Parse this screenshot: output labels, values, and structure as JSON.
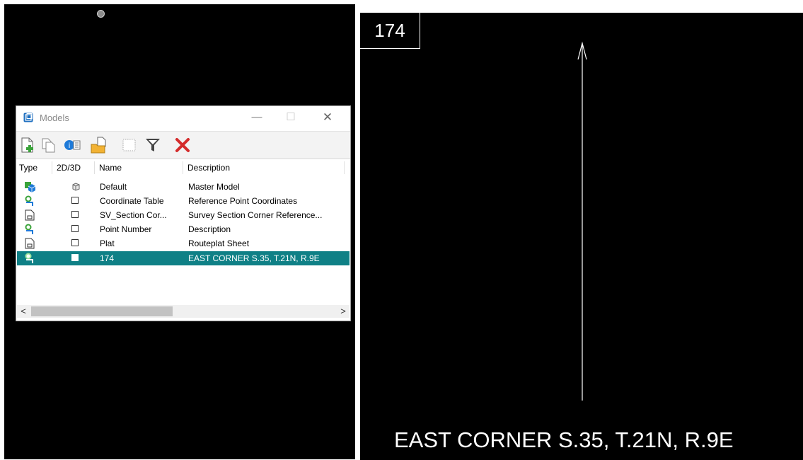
{
  "dialog": {
    "title": "Models",
    "controls": {
      "minimize": "—",
      "maximize": "☐",
      "close": "✕"
    },
    "toolbar": [
      {
        "icon": "new-model-icon"
      },
      {
        "icon": "copy-model-icon"
      },
      {
        "icon": "model-properties-icon"
      },
      {
        "icon": "import-model-icon"
      },
      {
        "icon": "select-icon"
      },
      {
        "icon": "filter-icon"
      },
      {
        "icon": "delete-icon"
      }
    ],
    "columns": [
      "Type",
      "2D/3D",
      "Name",
      "Description"
    ],
    "rows": [
      {
        "type_icon": "3d-model-icon",
        "dim_icon": "cube-icon",
        "name": "Default",
        "description": "Master Model",
        "selected": false
      },
      {
        "type_icon": "design-model-icon",
        "dim_icon": "square-icon",
        "name": "Coordinate Table",
        "description": "Reference Point Coordinates",
        "selected": false
      },
      {
        "type_icon": "sheet-model-icon",
        "dim_icon": "square-icon",
        "name": "SV_Section Cor...",
        "description": "Survey Section Corner Reference...",
        "selected": false
      },
      {
        "type_icon": "design-model-icon",
        "dim_icon": "square-icon",
        "name": "Point Number",
        "description": "Description",
        "selected": false
      },
      {
        "type_icon": "sheet-model-icon",
        "dim_icon": "square-icon",
        "name": "Plat",
        "description": "Routeplat Sheet",
        "selected": false
      },
      {
        "type_icon": "design-model-icon",
        "dim_icon": "square-icon",
        "name": "174",
        "description": "EAST CORNER S.35, T.21N, R.9E",
        "selected": true
      }
    ],
    "scroll": {
      "left": "<",
      "right": ">"
    }
  },
  "sheet": {
    "label": "174",
    "caption": "EAST CORNER S.35, T.21N, R.9E"
  },
  "colors": {
    "selection": "#0f8086",
    "canvas": "#000000"
  }
}
